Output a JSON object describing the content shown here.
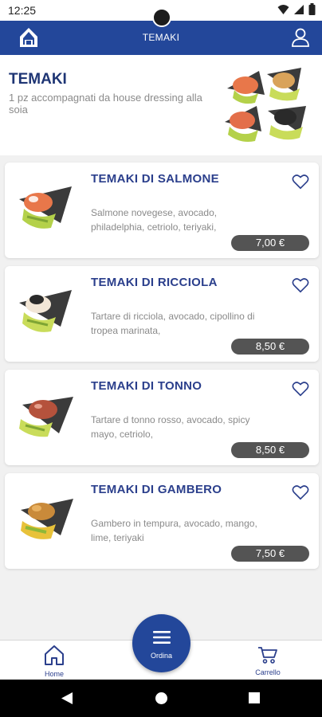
{
  "status_bar": {
    "time": "12:25"
  },
  "app_bar": {
    "title": "TEMAKI",
    "logo_icon": "onigiri-house-icon",
    "user_icon": "user-icon"
  },
  "header": {
    "title": "TEMAKI",
    "description": "1 pz accompagnati da house dressing alla soia"
  },
  "products": [
    {
      "name": "TEMAKI DI SALMONE",
      "description": "Salmone novegese, avocado, philadelphia, cetriolo, teriyaki,",
      "price": "7,00 €",
      "topping_color": "#e8774a"
    },
    {
      "name": "TEMAKI DI RICCIOLA",
      "description": "Tartare di ricciola, avocado, cipollino di tropea marinata,",
      "price": "8,50 €",
      "topping_color": "#2a2a2a"
    },
    {
      "name": "TEMAKI DI TONNO",
      "description": "Tartare d tonno rosso, avocado, spicy mayo, cetriolo,",
      "price": "8,50 €",
      "topping_color": "#b5523c"
    },
    {
      "name": "TEMAKI DI GAMBERO",
      "description": "Gambero in tempura, avocado, mango, lime, teriyaki",
      "price": "7,50 €",
      "topping_color": "#c98a3a"
    }
  ],
  "bottom_nav": {
    "home_label": "Home",
    "order_label": "Ordina",
    "cart_label": "Carrello"
  },
  "colors": {
    "brand": "#23479a",
    "title": "#2b3f8c",
    "price_badge": "#545454"
  }
}
